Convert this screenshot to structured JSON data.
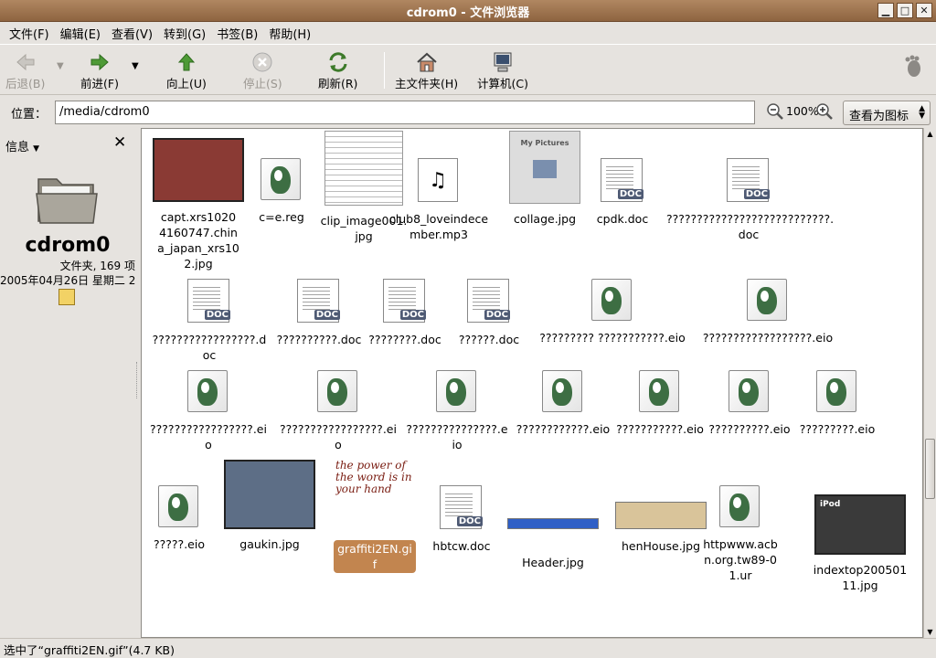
{
  "window": {
    "title": "cdrom0 - 文件浏览器"
  },
  "menubar": [
    "文件(F)",
    "编辑(E)",
    "查看(V)",
    "转到(G)",
    "书签(B)",
    "帮助(H)"
  ],
  "toolbar": {
    "back": "后退(B)",
    "forward": "前进(F)",
    "up": "向上(U)",
    "stop": "停止(S)",
    "reload": "刷新(R)",
    "home": "主文件夹(H)",
    "computer": "计算机(C)"
  },
  "location": {
    "label": "位置：",
    "value": "/media/cdrom0",
    "zoom": "100%",
    "view_mode": "查看为图标"
  },
  "sidebar": {
    "selector": "信息",
    "name": "cdrom0",
    "meta": "文件夹, 169 项",
    "date": "2005年04月26日 星期二 2"
  },
  "files": [
    {
      "label": "capt.xrs10204160747.china_japan_xrs102.jpg",
      "kind": "photo",
      "color": "#8a3a34"
    },
    {
      "label": "c=e.reg",
      "kind": "gnome"
    },
    {
      "label": "clip_image001.jpg",
      "kind": "sheet"
    },
    {
      "label": "club8_loveindecember.mp3",
      "kind": "music"
    },
    {
      "label": "collage.jpg",
      "kind": "collage",
      "caption": "My Pictures"
    },
    {
      "label": "cpdk.doc",
      "kind": "doc"
    },
    {
      "label": "???????????????????????????.doc",
      "kind": "doc"
    },
    {
      "label": "?????????????????.doc",
      "kind": "doc"
    },
    {
      "label": "??????????.doc",
      "kind": "doc"
    },
    {
      "label": "????????.doc",
      "kind": "doc"
    },
    {
      "label": "??????.doc",
      "kind": "doc"
    },
    {
      "label": "????????? ???????????.eio",
      "kind": "gnome"
    },
    {
      "label": "??????????????????.eio",
      "kind": "gnome"
    },
    {
      "label": "?????????????????.eio",
      "kind": "gnome"
    },
    {
      "label": "?????????????????.eio",
      "kind": "gnome"
    },
    {
      "label": "???????????????.eio",
      "kind": "gnome"
    },
    {
      "label": "????????????.eio",
      "kind": "gnome"
    },
    {
      "label": "???????????.eio",
      "kind": "gnome"
    },
    {
      "label": "??????????.eio",
      "kind": "gnome"
    },
    {
      "label": "?????????.eio",
      "kind": "gnome"
    },
    {
      "label": "?????.eio",
      "kind": "gnome"
    },
    {
      "label": "gaukin.jpg",
      "kind": "photo",
      "color": "#5d6e86"
    },
    {
      "label": "graffiti2EN.gif",
      "kind": "graffiti",
      "caption": "the power of the word is in your hand"
    },
    {
      "label": "hbtcw.doc",
      "kind": "doc"
    },
    {
      "label": "Header.jpg",
      "kind": "banner",
      "color": "#2f5fc6"
    },
    {
      "label": "henHouse.jpg",
      "kind": "banner",
      "color": "#d9c49a"
    },
    {
      "label": "httpwww.acbn.org.tw89-01.ur",
      "kind": "gnome"
    },
    {
      "label": "indextop20050111.jpg",
      "kind": "photo",
      "color": "#3a3a3a",
      "caption": "iPod"
    }
  ],
  "status": "选中了“graffiti2EN.gif”(4.7 KB)"
}
